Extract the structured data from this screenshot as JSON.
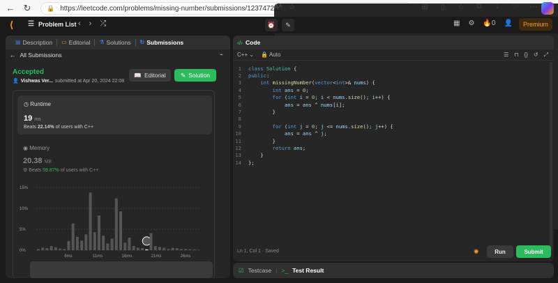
{
  "browser": {
    "url": "https://leetcode.com/problems/missing-number/submissions/1237472532/",
    "read_aloud": "Aᴬ",
    "icons": [
      "back-icon",
      "refresh-icon",
      "home-icon"
    ]
  },
  "header": {
    "problem_list": "Problem List",
    "premium": "Premium",
    "streak": "0"
  },
  "tabs": [
    {
      "label": "Description",
      "icon": "description-icon"
    },
    {
      "label": "Editorial",
      "icon": "editorial-icon"
    },
    {
      "label": "Solutions",
      "icon": "solutions-icon"
    },
    {
      "label": "Submissions",
      "icon": "submissions-icon"
    }
  ],
  "submission": {
    "back_label": "All Submissions",
    "status": "Accepted",
    "user": "Vishwas Ver...",
    "submitted": "submitted at Apr 20, 2024 22:08",
    "editorial_btn": "Editorial",
    "solution_btn": "Solution"
  },
  "runtime": {
    "label": "Runtime",
    "value": "19",
    "unit": "ms",
    "beats_prefix": "Beats",
    "beats_pct": "22.14%",
    "beats_suffix": "of users with C++"
  },
  "memory": {
    "label": "Memory",
    "value": "20.38",
    "unit": "MB",
    "beats_prefix": "Beats",
    "beats_pct": "59.87%",
    "beats_suffix": "of users with C++"
  },
  "chart_data": {
    "type": "bar",
    "ylim": [
      0,
      15
    ],
    "yticks": [
      "15%",
      "10%",
      "5%",
      "0%"
    ],
    "xticks": [
      "6ms",
      "11ms",
      "16ms",
      "21ms",
      "26ms"
    ],
    "values": [
      0.3,
      0.6,
      0.5,
      1.0,
      0.7,
      0.4,
      0.3,
      2.2,
      6.4,
      3.2,
      2.3,
      3.8,
      13.8,
      4.3,
      8.3,
      3.5,
      1.6,
      2.8,
      12.4,
      9.3,
      1.8,
      3.0,
      1.0,
      0.6,
      0.5,
      0.2,
      4.1,
      1.0,
      0.8,
      0.6,
      0.3,
      0.6,
      0.5,
      0.3,
      0.3,
      0.2,
      0.2,
      0.1
    ],
    "highlight_index": 25
  },
  "code": {
    "header": "Code",
    "language": "C++",
    "mode": "Auto",
    "status": "Ln 1, Col 1  ·  Saved",
    "run": "Run",
    "submit": "Submit",
    "lines": [
      "class Solution {",
      "public:",
      "    int missingNumber(vector<int>& nums) {",
      "        int ans = 0;",
      "        for (int i = 0; i < nums.size(); i++) {",
      "            ans = ans ^ nums[i];",
      "        }",
      "",
      "        for (int j = 0; j <= nums.size(); j++) {",
      "            ans = ans ^ j;",
      "        }",
      "        return ans;",
      "    }",
      "};"
    ]
  },
  "bottom": {
    "testcase": "Testcase",
    "result": "Test Result"
  }
}
